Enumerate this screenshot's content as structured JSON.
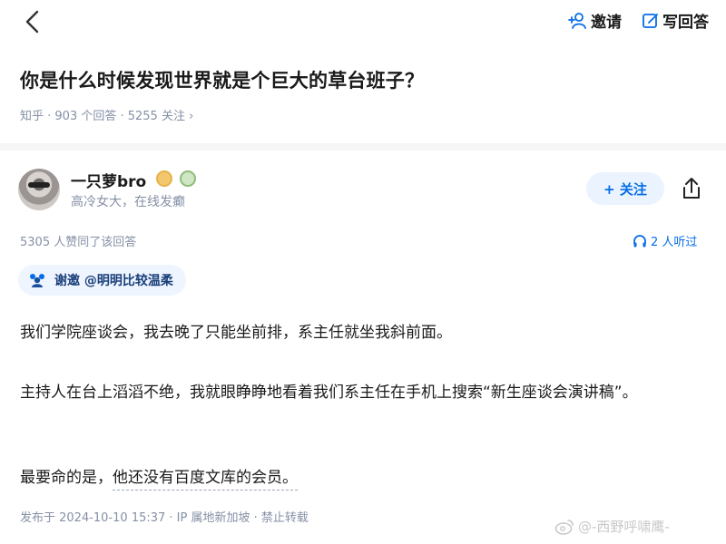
{
  "topbar": {
    "invite_label": "邀请",
    "write_label": "写回答"
  },
  "question": {
    "title": "你是什么时候发现世界就是个巨大的草台班子？",
    "meta": "知乎 · 903 个回答 · 5255 关注 ›"
  },
  "author": {
    "name": "一只萝bro",
    "description": "高冷女大，在线发癫",
    "follow_label": "+ 关注"
  },
  "answer": {
    "votes": "5305 人赞同了该回答",
    "listen": "2 人听过",
    "invite_tag": "谢邀 @明明比较温柔",
    "paragraphs": [
      "我们学院座谈会，我去晚了只能坐前排，系主任就坐我斜前面。",
      "主持人在台上滔滔不绝，我就眼睁睁地看着我们系主任在手机上搜索“新生座谈会演讲稿”。",
      "最要命的是，",
      "他还没有百度文库的会员。"
    ],
    "publish_info": "发布于 2024-10-10 15:37 · IP 属地新加坡 · 禁止转载"
  },
  "watermark": "@-西野呼啸鹰-",
  "colors": {
    "accent": "#056de8",
    "muted": "#8590a6",
    "follow_bg": "#ebf3ff",
    "invite_bg": "#eef5ff"
  }
}
